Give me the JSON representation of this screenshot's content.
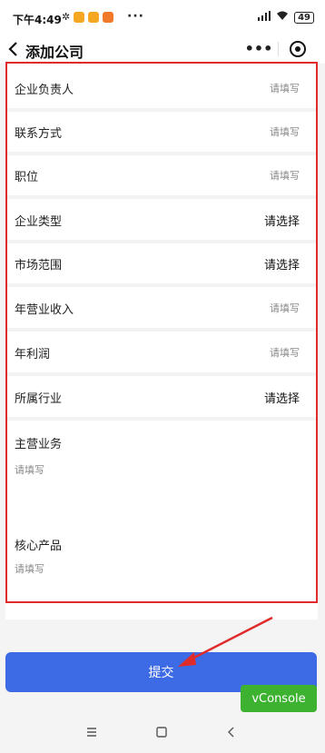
{
  "status": {
    "time": "下午4:49",
    "battery": "49"
  },
  "nav": {
    "title": "添加公司",
    "more": "•••"
  },
  "form": {
    "rows": [
      {
        "label": "企业负责人",
        "value": "请填写"
      },
      {
        "label": "联系方式",
        "value": "请填写"
      },
      {
        "label": "职位",
        "value": "请填写"
      },
      {
        "label": "企业类型",
        "value": "请选择"
      },
      {
        "label": "市场范围",
        "value": "请选择"
      },
      {
        "label": "年营业收入",
        "value": "请填写"
      },
      {
        "label": "年利润",
        "value": "请填写"
      },
      {
        "label": "所属行业",
        "value": "请选择"
      }
    ],
    "main_business": {
      "label": "主营业务",
      "placeholder": "请填写"
    },
    "core_product": {
      "label": "核心产品",
      "placeholder": "请填写"
    }
  },
  "submit_label": "提交",
  "vconsole_label": "vConsole",
  "colors": {
    "accent": "#3d6be6",
    "vconsole": "#3cb230",
    "highlight_border": "#e02b2b"
  }
}
